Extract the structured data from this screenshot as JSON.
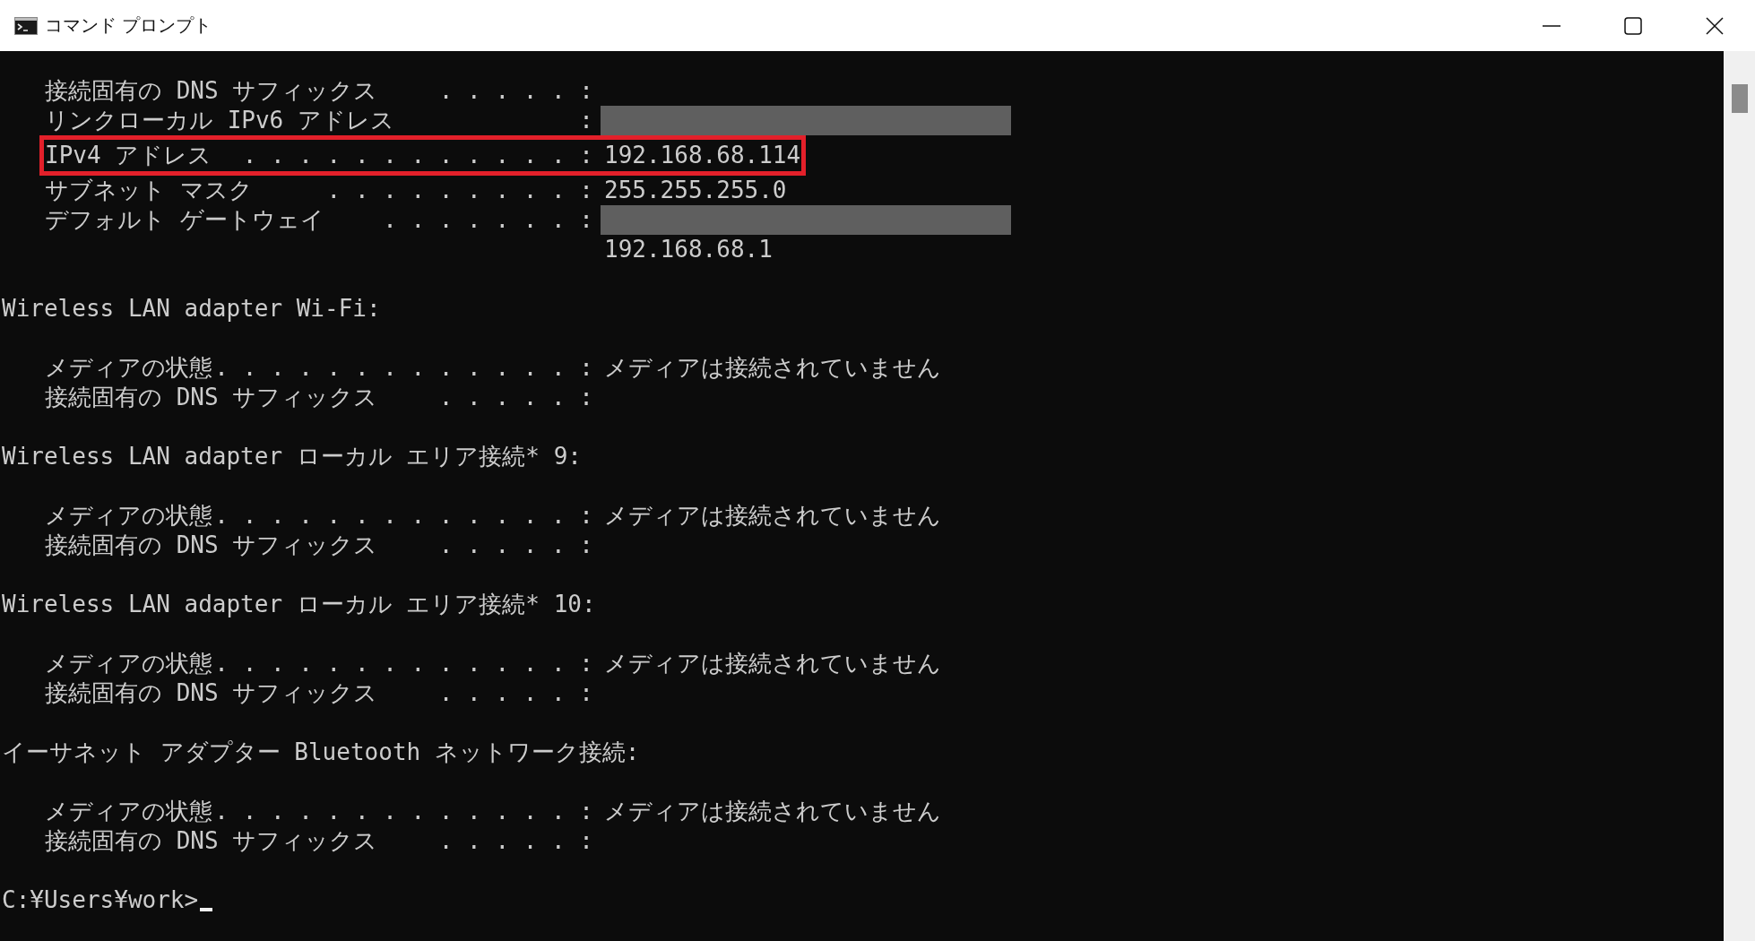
{
  "window": {
    "title": "コマンド プロンプト"
  },
  "console": {
    "lines": [
      {
        "kind": "entry",
        "label": "接続固有の DNS サフィックス",
        "leader": ". . . . . :",
        "redacted": false,
        "highlighted": false
      },
      {
        "kind": "entry",
        "label": "リンクローカル IPv6 アドレス",
        "leader": ":",
        "redacted": true,
        "highlighted": false
      },
      {
        "kind": "entry",
        "label": "IPv4 アドレス",
        "leader": ". . . . . . . . . . . . :",
        "value": "192.168.68.114",
        "redacted": false,
        "highlighted": true
      },
      {
        "kind": "entry",
        "label": "サブネット マスク",
        "leader": ". . . . . . . . . :",
        "value": "255.255.255.0",
        "redacted": false,
        "highlighted": false
      },
      {
        "kind": "entry",
        "label": "デフォルト ゲートウェイ",
        "leader": ". . . . . . . :",
        "redacted": true,
        "highlighted": false
      },
      {
        "kind": "continuation",
        "value": "192.168.68.1"
      },
      {
        "kind": "blank"
      },
      {
        "kind": "heading",
        "text": "Wireless LAN adapter Wi-Fi:"
      },
      {
        "kind": "blank"
      },
      {
        "kind": "entry",
        "label": "メディアの状態",
        "leader": ". . . . . . . . . . . . . :",
        "value": "メディアは接続されていません",
        "redacted": false,
        "highlighted": false
      },
      {
        "kind": "entry",
        "label": "接続固有の DNS サフィックス",
        "leader": ". . . . . :",
        "redacted": false,
        "highlighted": false
      },
      {
        "kind": "blank"
      },
      {
        "kind": "heading",
        "text": "Wireless LAN adapter ローカル エリア接続* 9:"
      },
      {
        "kind": "blank"
      },
      {
        "kind": "entry",
        "label": "メディアの状態",
        "leader": ". . . . . . . . . . . . . :",
        "value": "メディアは接続されていません",
        "redacted": false,
        "highlighted": false
      },
      {
        "kind": "entry",
        "label": "接続固有の DNS サフィックス",
        "leader": ". . . . . :",
        "redacted": false,
        "highlighted": false
      },
      {
        "kind": "blank"
      },
      {
        "kind": "heading",
        "text": "Wireless LAN adapter ローカル エリア接続* 10:"
      },
      {
        "kind": "blank"
      },
      {
        "kind": "entry",
        "label": "メディアの状態",
        "leader": ". . . . . . . . . . . . . :",
        "value": "メディアは接続されていません",
        "redacted": false,
        "highlighted": false
      },
      {
        "kind": "entry",
        "label": "接続固有の DNS サフィックス",
        "leader": ". . . . . :",
        "redacted": false,
        "highlighted": false
      },
      {
        "kind": "blank"
      },
      {
        "kind": "heading",
        "text": "イーサネット アダプター Bluetooth ネットワーク接続:"
      },
      {
        "kind": "blank"
      },
      {
        "kind": "entry",
        "label": "メディアの状態",
        "leader": ". . . . . . . . . . . . . :",
        "value": "メディアは接続されていません",
        "redacted": false,
        "highlighted": false
      },
      {
        "kind": "entry",
        "label": "接続固有の DNS サフィックス",
        "leader": ". . . . . :",
        "redacted": false,
        "highlighted": false
      },
      {
        "kind": "blank"
      },
      {
        "kind": "prompt",
        "text": "C:¥Users¥work>"
      }
    ]
  }
}
